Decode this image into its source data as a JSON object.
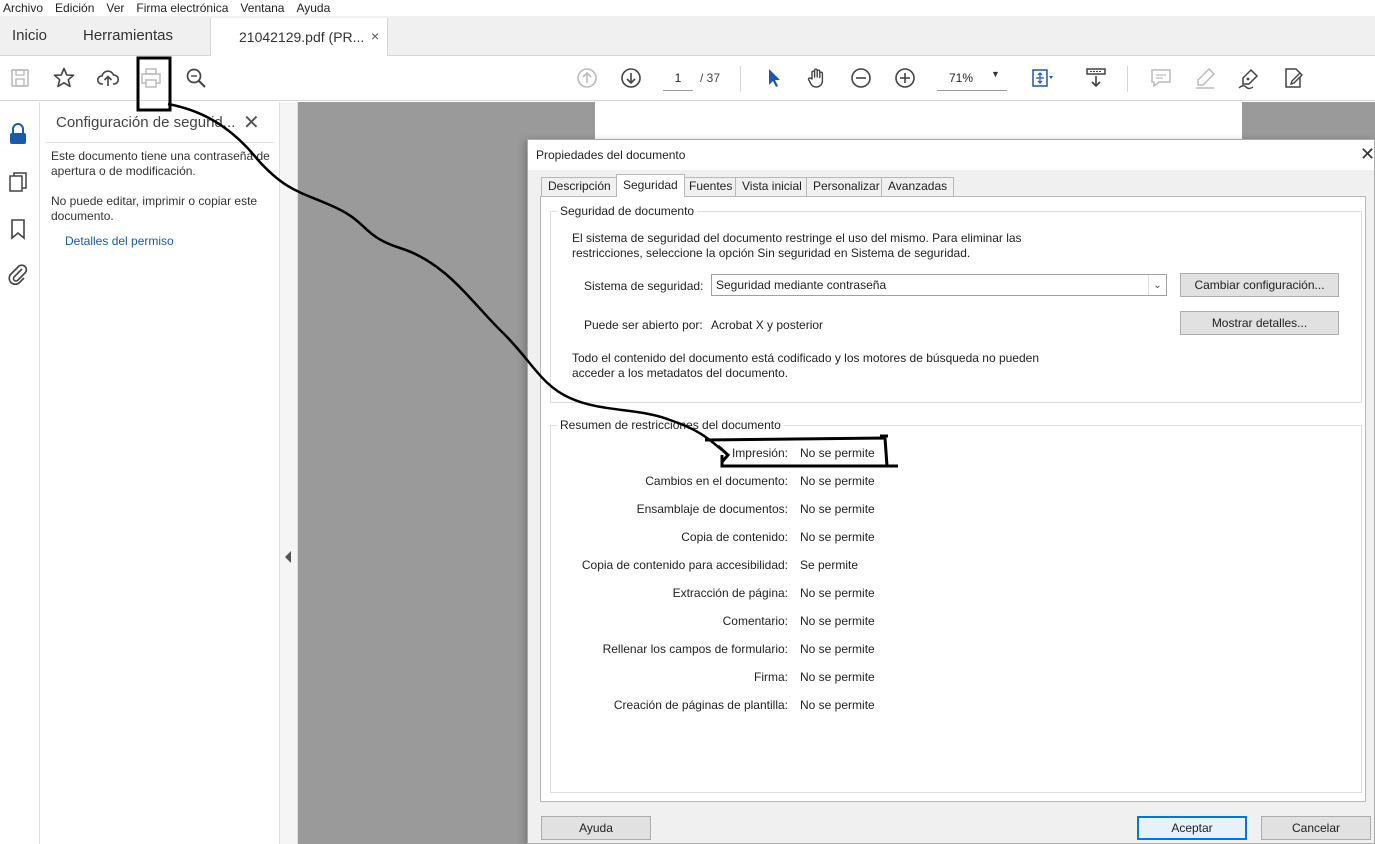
{
  "menu": [
    "Archivo",
    "Edición",
    "Ver",
    "Firma electrónica",
    "Ventana",
    "Ayuda"
  ],
  "tabs": {
    "home": "Inicio",
    "tools": "Herramientas",
    "document": "21042129.pdf (PR...",
    "close": "×"
  },
  "toolbar": {
    "icons": [
      "save-icon",
      "star-icon",
      "cloud-upload-icon",
      "print-icon",
      "search-zoom-icon",
      "arrow-up-icon",
      "arrow-down-icon",
      "select-cursor-icon",
      "hand-icon",
      "zoom-out-icon",
      "zoom-in-icon",
      "fit-page-icon",
      "scroll-mode-icon",
      "comment-icon",
      "highlight-icon",
      "sign-icon",
      "edit-icon"
    ],
    "page_current": "1",
    "page_total": "/ 37",
    "zoom": "71%"
  },
  "sidebar": {
    "icons": [
      "lock-icon",
      "pages-icon",
      "bookmark-icon",
      "attachment-icon"
    ]
  },
  "security_panel": {
    "title": "Configuración de segurid...",
    "close": "✕",
    "text1": "Este documento tiene una contraseña de apertura o de modificación.",
    "text2": "No puede editar, imprimir o copiar este documento.",
    "link": "Detalles del permiso"
  },
  "dialog": {
    "title": "Propiedades del documento",
    "close": "✕",
    "tabs": [
      "Descripción",
      "Seguridad",
      "Fuentes",
      "Vista inicial",
      "Personalizar",
      "Avanzadas"
    ],
    "active_tab": "Seguridad",
    "security_group": {
      "legend": "Seguridad de documento",
      "intro_line1": "El sistema de seguridad del documento restringe el uso del mismo. Para eliminar las",
      "intro_line2": "restricciones, seleccione la opción Sin seguridad en Sistema de seguridad.",
      "system_label": "Sistema de seguridad:",
      "system_value": "Seguridad mediante contraseña",
      "change_button": "Cambiar configuración...",
      "open_label": "Puede ser abierto por:",
      "open_value": "Acrobat X y posterior",
      "details_button": "Mostrar detalles...",
      "note_line1": "Todo el contenido del documento está codificado y los motores de búsqueda no pueden",
      "note_line2": "acceder a los metadatos del documento."
    },
    "restrictions_group": {
      "legend": "Resumen de restricciones del documento",
      "rows": [
        {
          "label": "Impresión:",
          "value": "No se permite"
        },
        {
          "label": "Cambios en el documento:",
          "value": "No se permite"
        },
        {
          "label": "Ensamblaje de documentos:",
          "value": "No se permite"
        },
        {
          "label": "Copia de contenido:",
          "value": "No se permite"
        },
        {
          "label": "Copia de contenido para accesibilidad:",
          "value": "Se permite"
        },
        {
          "label": "Extracción de página:",
          "value": "No se permite"
        },
        {
          "label": "Comentario:",
          "value": "No se permite"
        },
        {
          "label": "Rellenar los campos de formulario:",
          "value": "No se permite"
        },
        {
          "label": "Firma:",
          "value": "No se permite"
        },
        {
          "label": "Creación de páginas de plantilla:",
          "value": "No se permite"
        }
      ]
    },
    "buttons": {
      "help": "Ayuda",
      "ok": "Aceptar",
      "cancel": "Cancelar"
    }
  }
}
